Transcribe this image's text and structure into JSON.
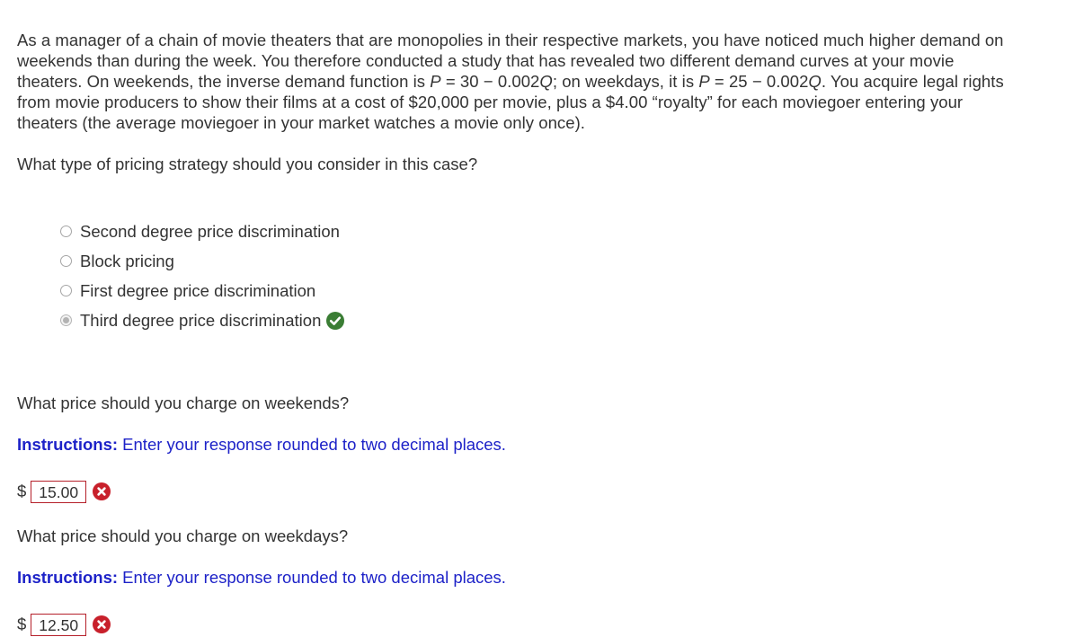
{
  "problem": {
    "line1": "As a manager of a chain of movie theaters that are monopolies in their respective markets, you have noticed much higher demand on",
    "line2": "weekends than during the week. You therefore conducted a study that has revealed two different demand curves at your movie",
    "line3_a": "theaters. On weekends, the inverse demand function is ",
    "line3_p1": "P",
    "line3_b": " = 30 − 0.002",
    "line3_q1": "Q",
    "line3_c": "; on weekdays, it is ",
    "line3_p2": "P",
    "line3_d": " = 25 − 0.002",
    "line3_q2": "Q",
    "line3_e": ". You acquire legal rights",
    "line4": "from movie producers to show their films at a cost of $20,000 per movie, plus a $4.00 “royalty” for each moviegoer entering your",
    "line5": "theaters (the average moviegoer in your market watches a movie only once)."
  },
  "question1": {
    "text": "What type of pricing strategy should you consider in this case?",
    "options": [
      {
        "label": "Second degree price discrimination",
        "selected": false
      },
      {
        "label": "Block pricing",
        "selected": false
      },
      {
        "label": "First degree price discrimination",
        "selected": false
      },
      {
        "label": "Third degree price discrimination",
        "selected": true,
        "status": "correct"
      }
    ],
    "correct_icon": "check-circle-icon",
    "correct_color": "#3a7d34"
  },
  "question2": {
    "text": "What price should you charge on weekends?",
    "instructions_bold": "Instructions:",
    "instructions_text": " Enter your response rounded to two decimal places.",
    "currency": "$",
    "value": "15.00",
    "status": "incorrect",
    "incorrect_icon": "x-circle-icon",
    "incorrect_color": "#c8202b"
  },
  "question3": {
    "text": "What price should you charge on weekdays?",
    "instructions_bold": "Instructions:",
    "instructions_text": " Enter your response rounded to two decimal places.",
    "currency": "$",
    "value": "12.50",
    "status": "incorrect",
    "incorrect_icon": "x-circle-icon",
    "incorrect_color": "#c8202b"
  },
  "colors": {
    "text": "#333333",
    "instructions": "#1d22c8",
    "input_border": "#b5202a"
  }
}
